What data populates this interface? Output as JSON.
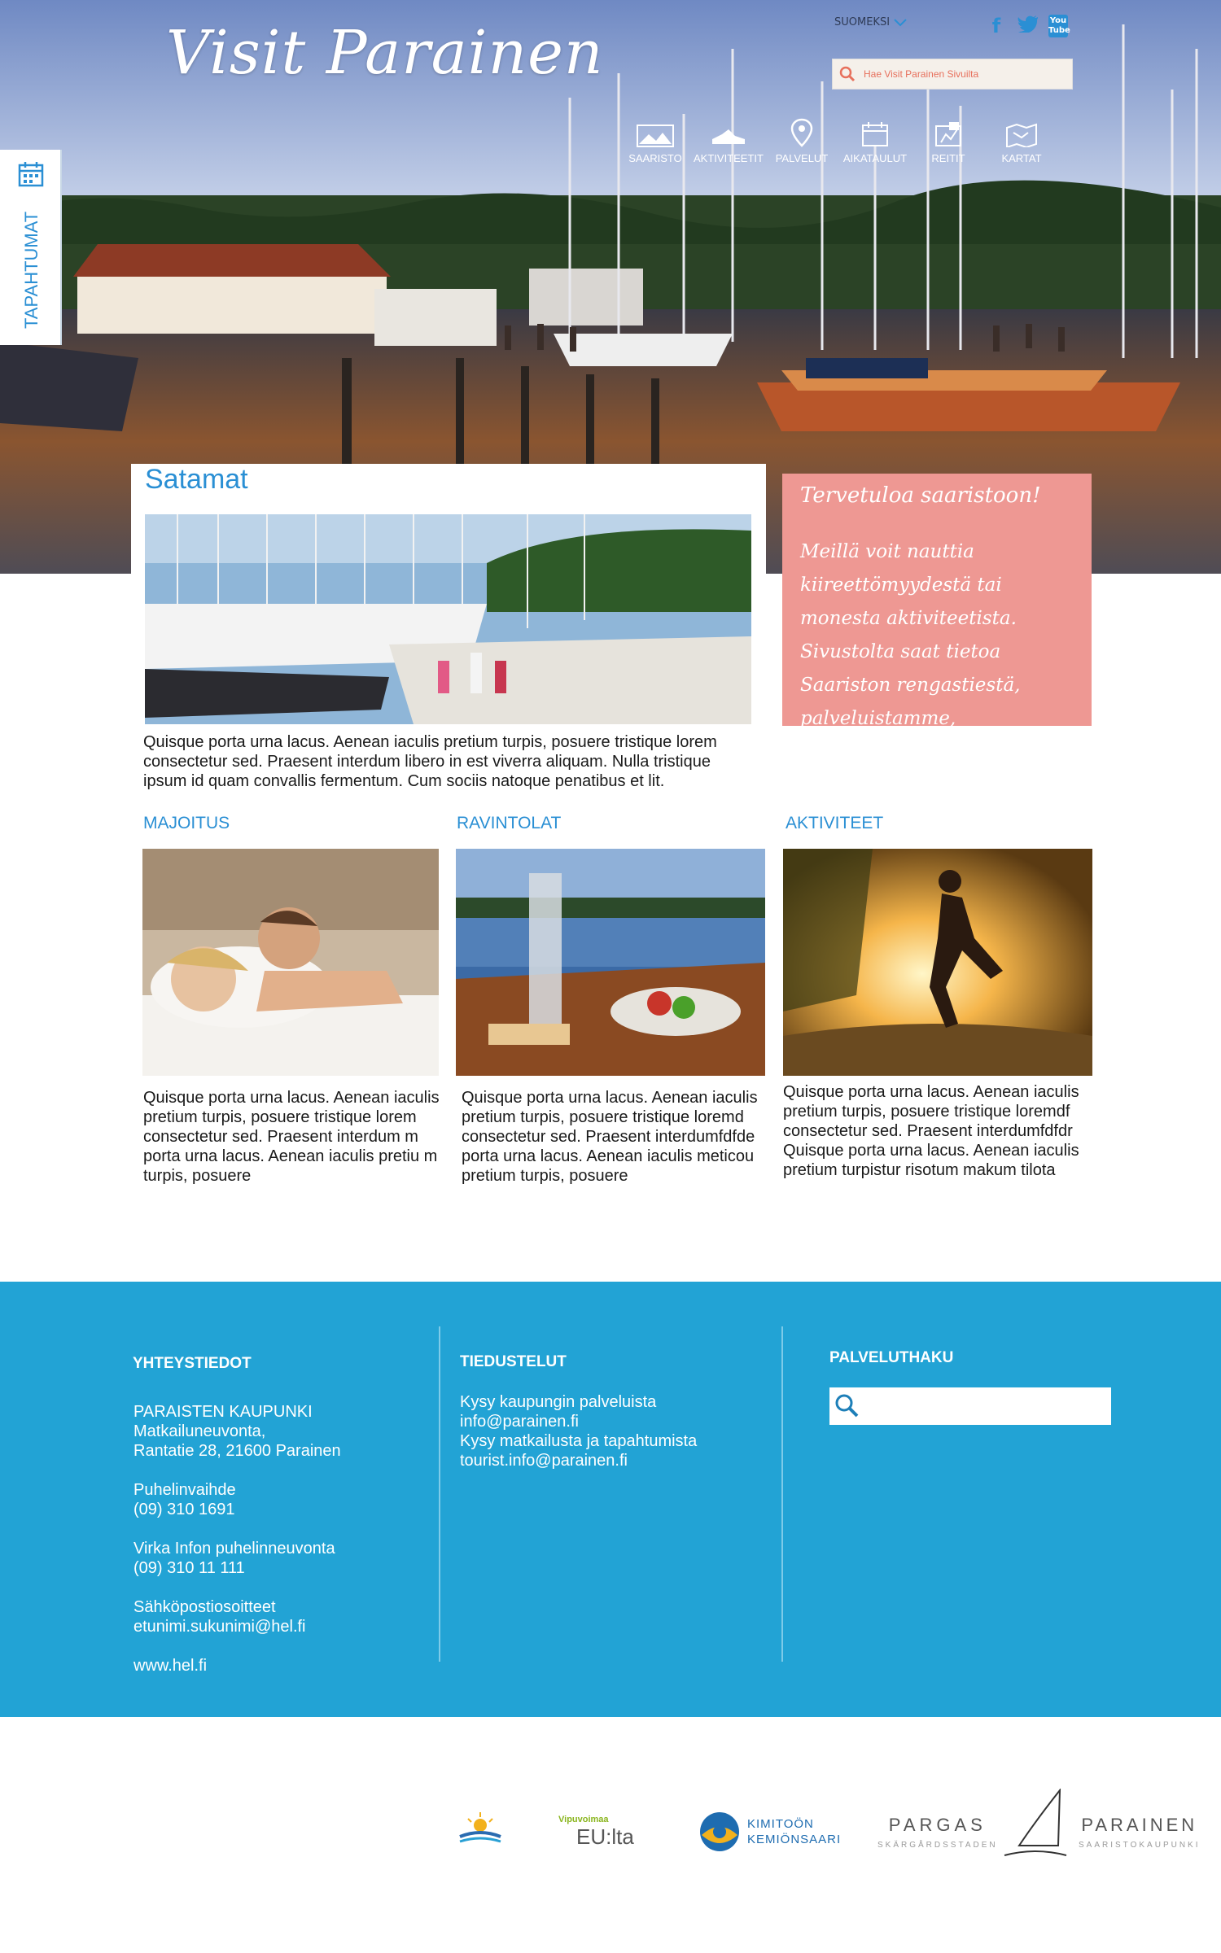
{
  "header": {
    "logo_text": "Visit Parainen",
    "language": "SUOMEKSI",
    "search_placeholder": "Hae Visit Parainen Sivuilta",
    "social": [
      "facebook-icon",
      "twitter-icon",
      "youtube-icon"
    ],
    "youtube_text": "You Tube"
  },
  "nav": [
    {
      "label": "SAARISTO",
      "icon": "island-icon"
    },
    {
      "label": "AKTIVITEETIT",
      "icon": "shoe-icon"
    },
    {
      "label": "PALVELUT",
      "icon": "location-pin-icon"
    },
    {
      "label": "AIKATAULUT",
      "icon": "calendar-icon"
    },
    {
      "label": "REITIT",
      "icon": "route-icon"
    },
    {
      "label": "KARTAT",
      "icon": "map-icon"
    }
  ],
  "events_tab": {
    "label": "TAPAHTUMAT",
    "icon": "calendar-icon"
  },
  "feature": {
    "title": "Satamat",
    "text": "Quisque porta urna lacus. Aenean iaculis pretium turpis, posuere tristique lorem consectetur sed. Praesent interdum  libero in est viverra aliquam. Nulla tristique ipsum id quam convallis fermentum. Cum sociis natoque penatibus et lit."
  },
  "welcome": {
    "title": "Tervetuloa saaristoon!",
    "body": "Meillä voit nauttia kiireettömyydestä tai monesta aktiviteetista. Sivustolta saat tietoa Saariston rengastiestä, palveluistamme, nähtävyyksistä, tapahtumista, aikatauluista ym"
  },
  "columns": [
    {
      "title": "MAJOITUS",
      "text": "Quisque porta urna lacus. Aenean iaculis pretium turpis, posuere tristique lorem consectetur sed. Praesent interdum  m porta urna lacus. Aenean iaculis pretiu m turpis, posuere"
    },
    {
      "title": "RAVINTOLAT",
      "text": "Quisque porta urna lacus. Aenean iaculis pretium turpis, posuere tristique loremd consectetur sed. Praesent interdumfdfde porta urna lacus. Aenean iaculis meticou pretium turpis, posuere"
    },
    {
      "title": "AKTIVITEET",
      "text": "Quisque porta urna lacus. Aenean iaculis pretium turpis, posuere tristique loremdf consectetur sed. Praesent interdumfdfdr Quisque porta urna lacus. Aenean iaculis pretium turpistur risotum  makum tilota"
    }
  ],
  "footer": {
    "contact": {
      "heading": "YHTEYSTIEDOT",
      "org": "PARAISTEN KAUPUNKI\nMatkailuneuvonta,\nRantatie 28, 21600 Parainen",
      "switchboard": "Puhelinvaihde\n(09) 310 1691",
      "virka": "Virka Infon puhelinneuvonta\n(09) 310 11 111",
      "email": "Sähköpostiosoitteet\netunimi.sukunimi@hel.fi",
      "web": "www.hel.fi"
    },
    "inquiries": {
      "heading": "TIEDUSTELUT",
      "text": "Kysy kaupungin palveluista\ninfo@parainen.fi\nKysy matkailusta ja tapahtumista\ntourist.info@parainen.fi"
    },
    "service_search": {
      "heading": "PALVELUTHAKU",
      "placeholder": ""
    }
  },
  "partners": {
    "eu_top": "Vipuvoimaa",
    "eu_main": "EU:lta",
    "kimito_1": "KIMITOÖN",
    "kimito_2": "KEMIÖNSAARI",
    "pargas_1": "PARGAS",
    "pargas_2": "SKÄRGÅRDSSTADEN",
    "parainen_1": "PARAINEN",
    "parainen_2": "SAARISTOKAUPUNKI"
  },
  "colors": {
    "accent_blue": "#2a8fd4",
    "footer_blue": "#22a3d5",
    "welcome_pink": "#ee9893"
  }
}
